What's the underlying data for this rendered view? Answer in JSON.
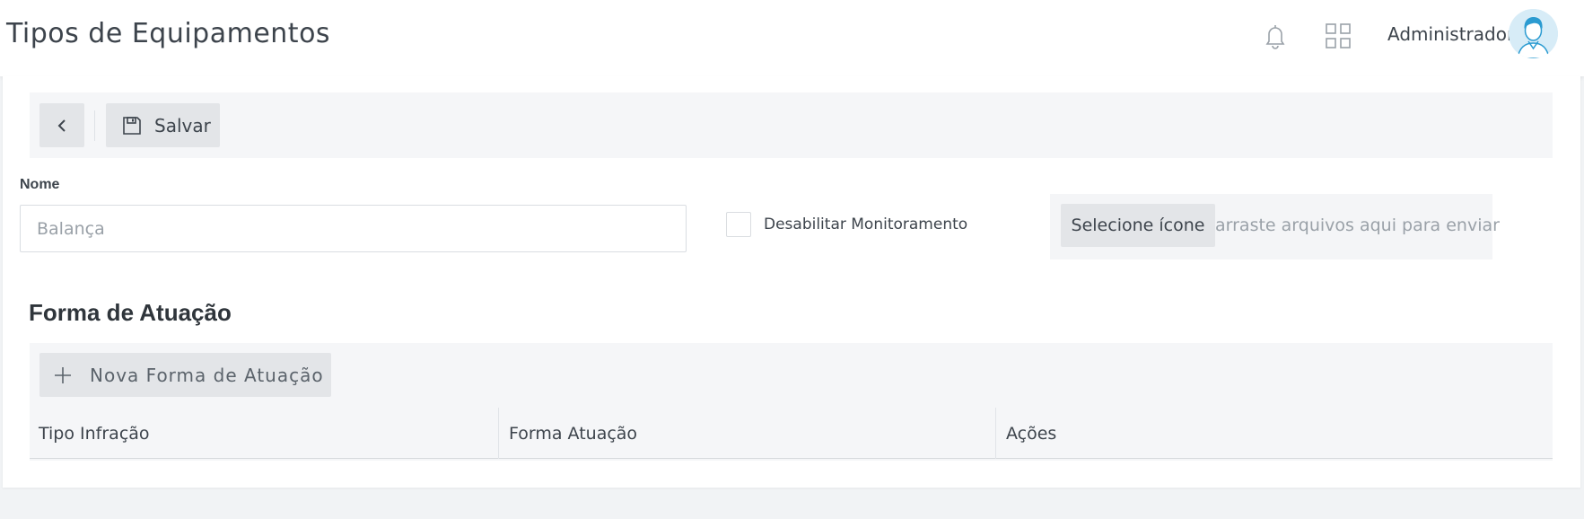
{
  "header": {
    "title": "Tipos de Equipamentos",
    "user_name": "Administrador",
    "icons": {
      "notifications": "bell-icon",
      "apps": "grid-icon",
      "avatar": "user-avatar-icon"
    }
  },
  "toolbar": {
    "back_icon": "chevron-left-icon",
    "save_icon": "floppy-disk-icon",
    "save_label": "Salvar"
  },
  "form": {
    "nome_label": "Nome",
    "nome_placeholder": "Balança",
    "nome_value": "",
    "monitor_label": "Desabilitar Monitoramento",
    "monitor_checked": false,
    "select_icon_label": "Selecione ícone",
    "upload_hint": "arraste arquivos aqui para enviar"
  },
  "section": {
    "title": "Forma de Atuação",
    "new_button_label": "Nova Forma de Atuação",
    "new_button_icon": "plus-icon",
    "table": {
      "columns": [
        "Tipo Infração",
        "Forma Atuação",
        "Ações"
      ],
      "rows": []
    }
  },
  "colors": {
    "background": "#f1f3f5",
    "panel": "#f5f6f8",
    "button": "#e3e5e8",
    "text": "#3d444c",
    "muted": "#9aa1a8",
    "avatar_bg": "#d7ecf7",
    "avatar_line": "#2b9bd1"
  }
}
